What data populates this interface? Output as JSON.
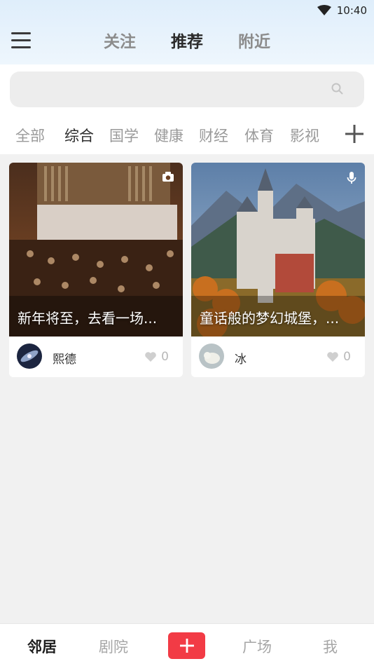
{
  "status": {
    "time": "10:40"
  },
  "top_tabs": [
    {
      "label": "关注"
    },
    {
      "label": "推荐"
    },
    {
      "label": "附近"
    }
  ],
  "search": {
    "placeholder": ""
  },
  "categories": [
    "全部",
    "综合",
    "国学",
    "健康",
    "财经",
    "体育",
    "影视"
  ],
  "cards": [
    {
      "title": "新年将至，去看一场...",
      "author": "熙德",
      "likes": "0",
      "media_icon": "camera-icon"
    },
    {
      "title": "童话般的梦幻城堡，...",
      "author": "冰",
      "likes": "0",
      "media_icon": "microphone-icon"
    }
  ],
  "bottom_nav": {
    "items": [
      "邻居",
      "剧院",
      "广场",
      "我"
    ]
  }
}
